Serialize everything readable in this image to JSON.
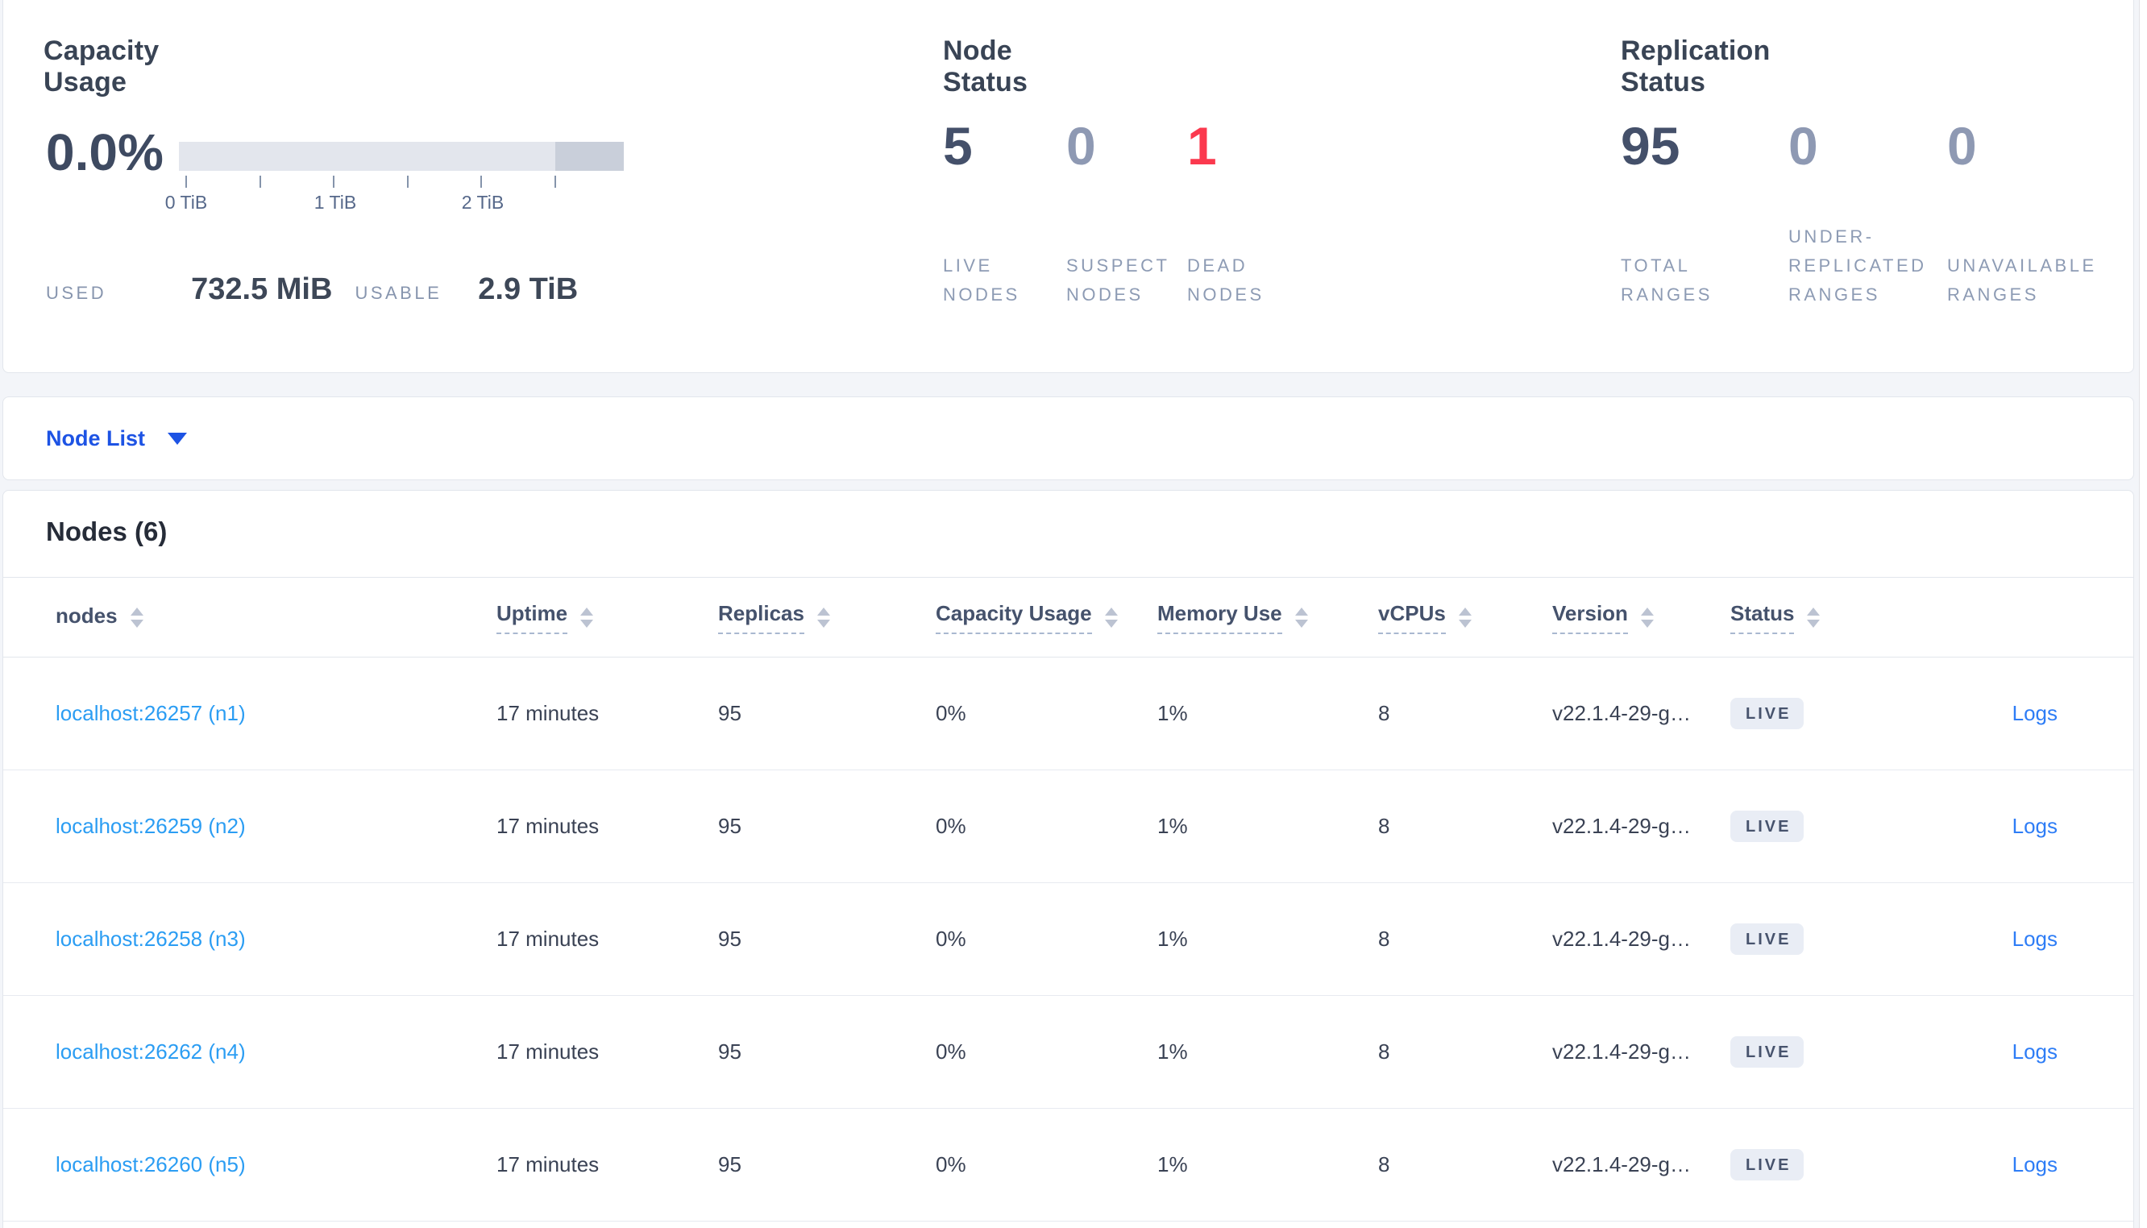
{
  "colors": {
    "page_background": "#f3f5f9",
    "card_border": "#e2e6ec",
    "title_text": "#394455",
    "stat_dark": "#44506a",
    "stat_muted": "#8e99b3",
    "stat_danger": "#fb394e",
    "label_muted": "#8d9bb4",
    "bar_light": "#e3e6ed",
    "bar_dark": "#c9cfda",
    "node_list_blue": "#1d53e4",
    "node_link_blue": "#2b9df3",
    "logs_link_blue": "#2e7df6",
    "badge_background": "#e9edf5",
    "badge_text": "#47536d"
  },
  "capacity": {
    "title": "Capacity Usage",
    "percent": "0.0%",
    "tick_labels": [
      "0 TiB",
      "1 TiB",
      "2 TiB"
    ],
    "used_label": "USED",
    "used_value": "732.5 MiB",
    "usable_label": "USABLE",
    "usable_value": "2.9 TiB"
  },
  "node_status": {
    "title": "Node Status",
    "stats": [
      {
        "value": "5",
        "label": "LIVE NODES"
      },
      {
        "value": "0",
        "label": "SUSPECT NODES"
      },
      {
        "value": "1",
        "label": "DEAD NODES"
      }
    ]
  },
  "replication_status": {
    "title": "Replication Status",
    "stats": [
      {
        "value": "95",
        "label": "TOTAL RANGES"
      },
      {
        "value": "0",
        "label": "UNDER-REPLICATED RANGES"
      },
      {
        "value": "0",
        "label": "UNAVAILABLE RANGES"
      }
    ]
  },
  "node_list": {
    "label": "Node List"
  },
  "nodes_table": {
    "heading": "Nodes (6)",
    "columns": [
      {
        "label": "nodes"
      },
      {
        "label": "Uptime"
      },
      {
        "label": "Replicas"
      },
      {
        "label": "Capacity Usage"
      },
      {
        "label": "Memory Use"
      },
      {
        "label": "vCPUs"
      },
      {
        "label": "Version"
      },
      {
        "label": "Status"
      }
    ],
    "rows": [
      {
        "node": "localhost:26257 (n1)",
        "uptime": "17 minutes",
        "replicas": "95",
        "capacity": "0%",
        "memory": "1%",
        "vcpus": "8",
        "version": "v22.1.4-29-g…",
        "status": "LIVE",
        "logs": "Logs"
      },
      {
        "node": "localhost:26259 (n2)",
        "uptime": "17 minutes",
        "replicas": "95",
        "capacity": "0%",
        "memory": "1%",
        "vcpus": "8",
        "version": "v22.1.4-29-g…",
        "status": "LIVE",
        "logs": "Logs"
      },
      {
        "node": "localhost:26258 (n3)",
        "uptime": "17 minutes",
        "replicas": "95",
        "capacity": "0%",
        "memory": "1%",
        "vcpus": "8",
        "version": "v22.1.4-29-g…",
        "status": "LIVE",
        "logs": "Logs"
      },
      {
        "node": "localhost:26262 (n4)",
        "uptime": "17 minutes",
        "replicas": "95",
        "capacity": "0%",
        "memory": "1%",
        "vcpus": "8",
        "version": "v22.1.4-29-g…",
        "status": "LIVE",
        "logs": "Logs"
      },
      {
        "node": "localhost:26260 (n5)",
        "uptime": "17 minutes",
        "replicas": "95",
        "capacity": "0%",
        "memory": "1%",
        "vcpus": "8",
        "version": "v22.1.4-29-g…",
        "status": "LIVE",
        "logs": "Logs"
      }
    ]
  }
}
